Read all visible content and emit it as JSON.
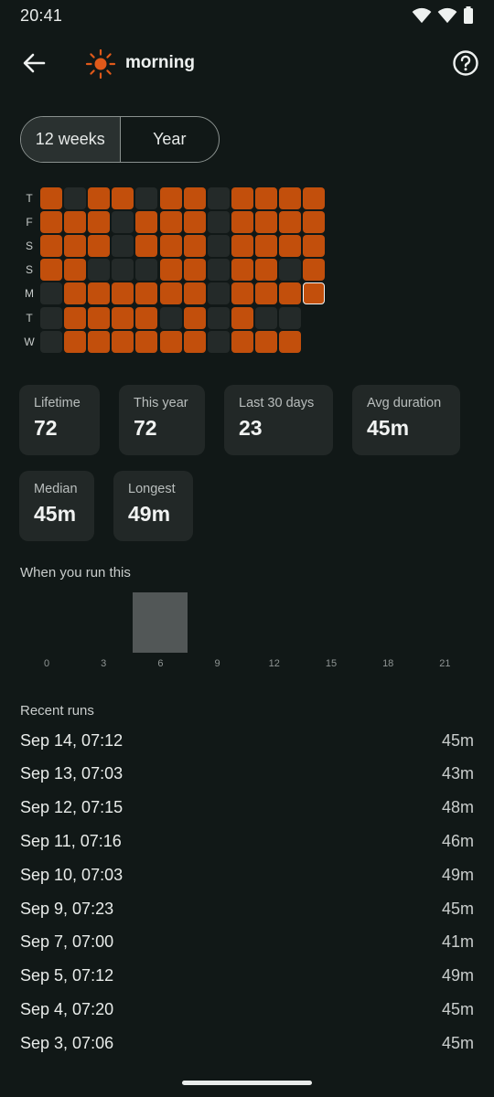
{
  "status_bar": {
    "time": "20:41"
  },
  "app_bar": {
    "title": "morning"
  },
  "range_toggle": {
    "options": [
      "12 weeks",
      "Year"
    ],
    "selected": "12 weeks"
  },
  "heatmap": {
    "row_labels": [
      "T",
      "F",
      "S",
      "S",
      "M",
      "T",
      "W"
    ],
    "rows": [
      [
        1,
        0,
        1,
        1,
        0,
        1,
        1,
        0,
        1,
        1,
        1,
        1
      ],
      [
        1,
        1,
        1,
        0,
        1,
        1,
        1,
        0,
        1,
        1,
        1,
        1
      ],
      [
        1,
        1,
        1,
        0,
        1,
        1,
        1,
        0,
        1,
        1,
        1,
        1
      ],
      [
        1,
        1,
        0,
        0,
        0,
        1,
        1,
        0,
        1,
        1,
        0,
        1
      ],
      [
        0,
        1,
        1,
        1,
        1,
        1,
        1,
        0,
        1,
        1,
        1,
        2
      ],
      [
        0,
        1,
        1,
        1,
        1,
        0,
        1,
        0,
        1,
        0,
        0,
        -1
      ],
      [
        0,
        1,
        1,
        1,
        1,
        1,
        1,
        0,
        1,
        1,
        1,
        -1
      ]
    ],
    "colors": {
      "active": "#c24f0c",
      "inactive": "#242a29"
    }
  },
  "stats": [
    {
      "label": "Lifetime",
      "value": "72"
    },
    {
      "label": "This year",
      "value": "72"
    },
    {
      "label": "Last 30 days",
      "value": "23"
    },
    {
      "label": "Avg duration",
      "value": "45m"
    },
    {
      "label": "Median",
      "value": "45m"
    },
    {
      "label": "Longest",
      "value": "49m"
    }
  ],
  "hour_section": {
    "title": "When you run this"
  },
  "chart_data": {
    "type": "bar",
    "x": [
      0,
      3,
      6,
      9,
      12,
      15,
      18,
      21
    ],
    "tick_labels": [
      "0",
      "3",
      "6",
      "9",
      "12",
      "15",
      "18",
      "21"
    ],
    "values": [
      0,
      0,
      72,
      0,
      0,
      0,
      0,
      0
    ],
    "title": "When you run this",
    "xlabel": "",
    "ylabel": "",
    "grid": false
  },
  "recent_runs": {
    "title": "Recent runs",
    "items": [
      {
        "date": "Sep 14, 07:12",
        "duration": "45m"
      },
      {
        "date": "Sep 13, 07:03",
        "duration": "43m"
      },
      {
        "date": "Sep 12, 07:15",
        "duration": "48m"
      },
      {
        "date": "Sep 11, 07:16",
        "duration": "46m"
      },
      {
        "date": "Sep 10, 07:03",
        "duration": "49m"
      },
      {
        "date": "Sep 9, 07:23",
        "duration": "45m"
      },
      {
        "date": "Sep 7, 07:00",
        "duration": "41m"
      },
      {
        "date": "Sep 5, 07:12",
        "duration": "49m"
      },
      {
        "date": "Sep 4, 07:20",
        "duration": "45m"
      },
      {
        "date": "Sep 3, 07:06",
        "duration": "45m"
      }
    ]
  },
  "icons": {
    "back": "arrow-back-icon",
    "sun": "sun-icon",
    "help": "help-circle-icon",
    "wifi": "wifi-icon",
    "battery": "battery-icon"
  }
}
